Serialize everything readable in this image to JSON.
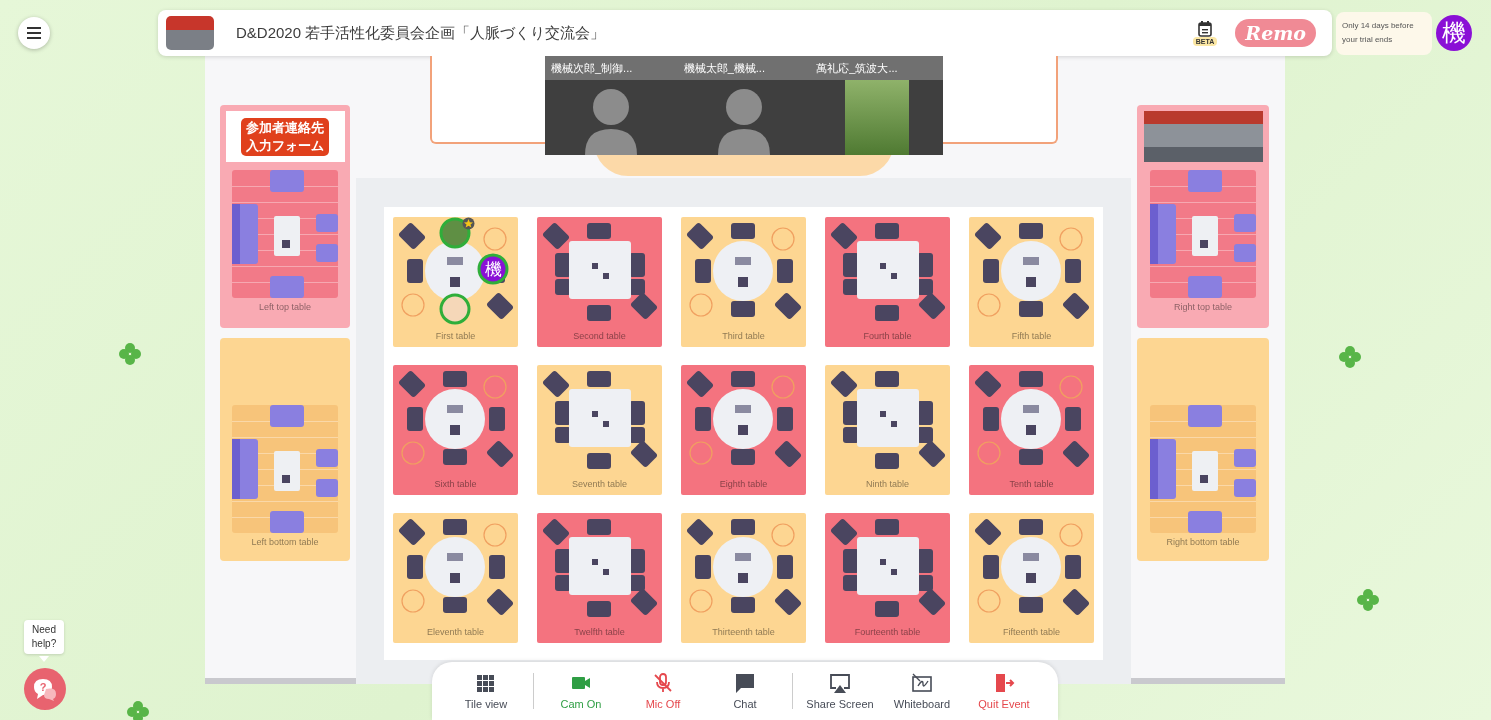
{
  "header": {
    "title": "D&D2020 若手活性化委員会企画「人脈づくり交流会」",
    "calendar_badge": "BETA",
    "logo": "Remo"
  },
  "trial": {
    "notice": "Only 14 days before your trial ends",
    "avatar": "機"
  },
  "stage": {
    "videos": [
      {
        "name": "機械次郎_制御...",
        "kind": "cartoon"
      },
      {
        "name": "機械太郎_機械...",
        "kind": "cartoon"
      },
      {
        "name": "萬礼応_筑波大...",
        "kind": "photo"
      }
    ]
  },
  "side_tables": {
    "left": [
      {
        "label": "Left top table",
        "color": "#f9aab3",
        "banner": {
          "kind": "text",
          "text": "参加者連絡先入力フォーム"
        }
      },
      {
        "label": "Left bottom table",
        "color": "#fdd692"
      }
    ],
    "right": [
      {
        "label": "Right top table",
        "color": "#f9aab3",
        "banner": {
          "kind": "photo"
        }
      },
      {
        "label": "Right bottom table",
        "color": "#fdd692"
      }
    ]
  },
  "tables": [
    {
      "label": "First table",
      "color": "#fdd692",
      "kind": "round",
      "occupants": [
        {
          "kind": "photo",
          "host": true
        },
        {
          "kind": "letter",
          "text": "機",
          "host": false
        },
        {
          "kind": "cartoon",
          "host": false
        }
      ]
    },
    {
      "label": "Second table",
      "color": "#f4737f",
      "kind": "square"
    },
    {
      "label": "Third table",
      "color": "#fdd692",
      "kind": "round"
    },
    {
      "label": "Fourth table",
      "color": "#f4737f",
      "kind": "square"
    },
    {
      "label": "Fifth table",
      "color": "#fdd692",
      "kind": "round"
    },
    {
      "label": "Sixth table",
      "color": "#f4737f",
      "kind": "round"
    },
    {
      "label": "Seventh table",
      "color": "#fdd692",
      "kind": "square"
    },
    {
      "label": "Eighth table",
      "color": "#f4737f",
      "kind": "round"
    },
    {
      "label": "Ninth table",
      "color": "#fdd692",
      "kind": "square"
    },
    {
      "label": "Tenth table",
      "color": "#f4737f",
      "kind": "round"
    },
    {
      "label": "Eleventh table",
      "color": "#fdd692",
      "kind": "round"
    },
    {
      "label": "Twelfth table",
      "color": "#f4737f",
      "kind": "square"
    },
    {
      "label": "Thirteenth table",
      "color": "#fdd692",
      "kind": "round"
    },
    {
      "label": "Fourteenth table",
      "color": "#f4737f",
      "kind": "square"
    },
    {
      "label": "Fifteenth table",
      "color": "#fdd692",
      "kind": "round"
    }
  ],
  "toolbar": {
    "groups": [
      [
        {
          "label": "Tile view",
          "kind": "tiles",
          "color": "#474c57"
        }
      ],
      [
        {
          "label": "Cam On",
          "kind": "camera",
          "color": "#2f9e44"
        },
        {
          "label": "Mic Off",
          "kind": "mic-off",
          "color": "#e5484d"
        },
        {
          "label": "Chat",
          "kind": "chat",
          "color": "#474c57"
        }
      ],
      [
        {
          "label": "Share Screen",
          "kind": "share",
          "color": "#474c57"
        },
        {
          "label": "Whiteboard",
          "kind": "whiteboard",
          "color": "#474c57"
        },
        {
          "label": "Quit Event",
          "kind": "quit",
          "color": "#e5484d"
        }
      ]
    ]
  },
  "help": {
    "text": "Need help?",
    "glyph": "?"
  }
}
